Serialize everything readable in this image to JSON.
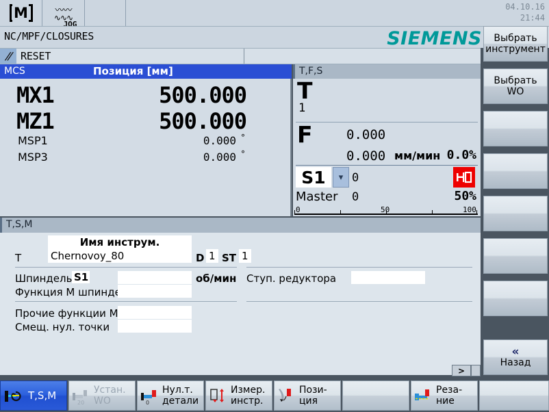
{
  "header": {
    "mode_icon": "machine-m-icon",
    "jog_icon": "jog-wave-icon",
    "jog_label": "JOG",
    "date": "04.10.16",
    "time": "21:44"
  },
  "pathbar": {
    "program_path": "NC/MPF/CLOSURES",
    "brand": "SIEMENS"
  },
  "status": {
    "icon": "reset-slash-icon",
    "text": "RESET"
  },
  "mcs": {
    "title": "MCS",
    "position_header": "Позиция [мм]",
    "axes": [
      {
        "name": "MX1",
        "value": "500.000",
        "unit": "",
        "size": "big"
      },
      {
        "name": "MZ1",
        "value": "500.000",
        "unit": "",
        "size": "big"
      },
      {
        "name": "MSP1",
        "value": "0.000",
        "unit": "°",
        "size": "small"
      },
      {
        "name": "MSP3",
        "value": "0.000",
        "unit": "°",
        "size": "small"
      }
    ]
  },
  "tfs": {
    "title": "T,F,S",
    "tool_label": "T",
    "tool_number": "1",
    "feed_label": "F",
    "feed_actual": "0.000",
    "feed_set": "0.000",
    "feed_unit": "мм/мин",
    "feed_percent": "0.0%",
    "spindle_name": "S1",
    "spindle_dropdown_icon": "chevron-down-icon",
    "spindle_value": "0",
    "spindle_stop_icon": "spindle-stopped-icon",
    "master_label": "Master",
    "master_value": "0",
    "master_percent": "50%",
    "scale_ticks": [
      "0",
      "50",
      "100"
    ]
  },
  "tsm": {
    "title": "T,S,M",
    "tool_name_header": "Имя инструм.",
    "tool_label": "T",
    "tool_name": "Chernovoy_80",
    "d_label": "D",
    "d_value": "1",
    "st_label": "ST",
    "st_value": "1",
    "spindle_label": "Шпиндель",
    "spindle_value": "S1",
    "spindle_speed": "",
    "spindle_unit": "об/мин",
    "gear_stage_label": "Ступ. редуктора",
    "gear_stage_value": "",
    "m_function_label": "Функция М шпинде.",
    "m_function_value": "",
    "other_m_label": "Прочие функции М",
    "other_m_value": "",
    "zero_offset_label": "Смещ. нул. точки",
    "zero_offset_value": "",
    "scroll_right_icon": "scroll-right-icon"
  },
  "vertical_softkeys": [
    {
      "lines": [
        "Выбрать",
        "инструмент"
      ],
      "empty": false
    },
    {
      "lines": [
        "Выбрать",
        "WO"
      ],
      "empty": false
    },
    {
      "lines": [],
      "empty": true
    },
    {
      "lines": [],
      "empty": true
    },
    {
      "lines": [],
      "empty": true
    },
    {
      "lines": [],
      "empty": true
    },
    {
      "lines": [
        "«",
        "Назад"
      ],
      "empty": false,
      "chevron": true
    }
  ],
  "horizontal_softkeys": [
    {
      "lines": [
        "T,S,M"
      ],
      "icon": "tsm-icon",
      "active": true,
      "disabled": false,
      "single": true
    },
    {
      "lines": [
        "Устан.",
        "WO"
      ],
      "icon": "set-wo-icon",
      "active": false,
      "disabled": true
    },
    {
      "lines": [
        "Нул.т.",
        "детали"
      ],
      "icon": "workpiece-zero-icon",
      "active": false,
      "disabled": false
    },
    {
      "lines": [
        "Измер.",
        "инстр."
      ],
      "icon": "measure-tool-icon",
      "active": false,
      "disabled": false
    },
    {
      "lines": [
        "Пози-",
        "ция"
      ],
      "icon": "position-icon",
      "active": false,
      "disabled": false
    },
    {
      "lines": [],
      "icon": "",
      "active": false,
      "disabled": false,
      "empty": true
    },
    {
      "lines": [
        "Реза-",
        "ние"
      ],
      "icon": "cutting-icon",
      "active": false,
      "disabled": false
    },
    {
      "lines": [],
      "icon": "",
      "active": false,
      "disabled": false,
      "empty": true
    }
  ],
  "colors": {
    "accent_blue": "#2a4ed4",
    "siemens_teal": "#009999",
    "panel_bg": "#d3dce5",
    "frame_gray": "#4a5560",
    "alarm_red": "#ee0000"
  }
}
